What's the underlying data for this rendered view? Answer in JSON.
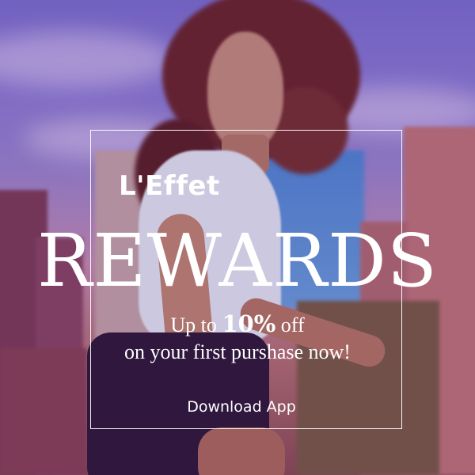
{
  "brand": {
    "name": "L'Effet"
  },
  "headline": "REWARDS",
  "offer": {
    "line1_prefix": "Up to",
    "line1_highlight": "10%",
    "line1_suffix": "off",
    "line2": "on your first purshase now!"
  },
  "cta": {
    "label": "Download App"
  },
  "colors": {
    "text": "#ffffff",
    "frame": "#ffffff"
  }
}
